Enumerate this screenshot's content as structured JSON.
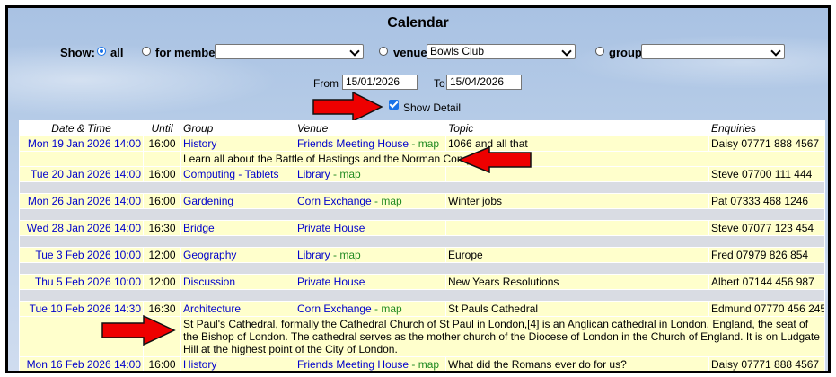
{
  "title": "Calendar",
  "filters": {
    "show_label": "Show:",
    "all_label": "all",
    "member_label": "for member",
    "member_value": "",
    "venue_label": "venue",
    "venue_value": "Bowls Club",
    "group_label": "group",
    "group_value": "",
    "from_label": "From",
    "from_value": "15/01/2026",
    "to_label": "To",
    "to_value": "15/04/2026",
    "detail_label": "Show Detail"
  },
  "table": {
    "headers": [
      "Date & Time",
      "Until",
      "Group",
      "Venue",
      "Topic",
      "Enquiries"
    ],
    "map_label": "map",
    "map_sep": " - ",
    "events": [
      {
        "date": "Mon 19 Jan 2026 14:00",
        "until": "16:00",
        "group": "History",
        "venue": "Friends Meeting House",
        "map": true,
        "topic": "1066 and all that",
        "enquiries": "Daisy 07771 888 4567",
        "detail": "Learn all about the Battle of Hastings and the Norman Conquest"
      },
      {
        "date": "Tue 20 Jan 2026 14:00",
        "until": "16:00",
        "group": "Computing - Tablets",
        "venue": "Library",
        "map": true,
        "topic": "",
        "enquiries": "Steve 07700 111 444",
        "detail": ""
      },
      {
        "date": "Mon 26 Jan 2026 14:00",
        "until": "16:00",
        "group": "Gardening",
        "venue": "Corn Exchange",
        "map": true,
        "topic": "Winter jobs",
        "enquiries": "Pat 07333 468 1246",
        "detail": ""
      },
      {
        "date": "Wed 28 Jan 2026 14:00",
        "until": "16:30",
        "group": "Bridge",
        "venue": "Private House",
        "map": false,
        "topic": "",
        "enquiries": "Steve 07077 123 454",
        "detail": ""
      },
      {
        "date": "Tue 3 Feb 2026 10:00",
        "until": "12:00",
        "group": "Geography",
        "venue": "Library",
        "map": true,
        "topic": "Europe",
        "enquiries": "Fred 07979 826 854",
        "detail": ""
      },
      {
        "date": "Thu 5 Feb 2026 10:00",
        "until": "12:00",
        "group": "Discussion",
        "venue": "Private House",
        "map": false,
        "topic": "New Years Resolutions",
        "enquiries": "Albert 07144 456 987",
        "detail": ""
      },
      {
        "date": "Tue 10 Feb 2026 14:30",
        "until": "16:30",
        "group": "Architecture",
        "venue": "Corn Exchange",
        "map": true,
        "topic": "St Pauls Cathedral",
        "enquiries": "Edmund 07770 456 245",
        "detail": "St Paul's Cathedral, formally the Cathedral Church of St Paul in London,[4] is an Anglican cathedral in London, England, the seat of the Bishop of London. The cathedral serves as the mother church of the Diocese of London in the Church of England. It is on Ludgate Hill at the highest point of the City of London."
      },
      {
        "date": "Mon 16 Feb 2026 14:00",
        "until": "16:00",
        "group": "History",
        "venue": "Friends Meeting House",
        "map": true,
        "topic": "What did the Romans ever do for us?",
        "enquiries": "Daisy 07771 888 4567",
        "detail": ""
      }
    ]
  }
}
